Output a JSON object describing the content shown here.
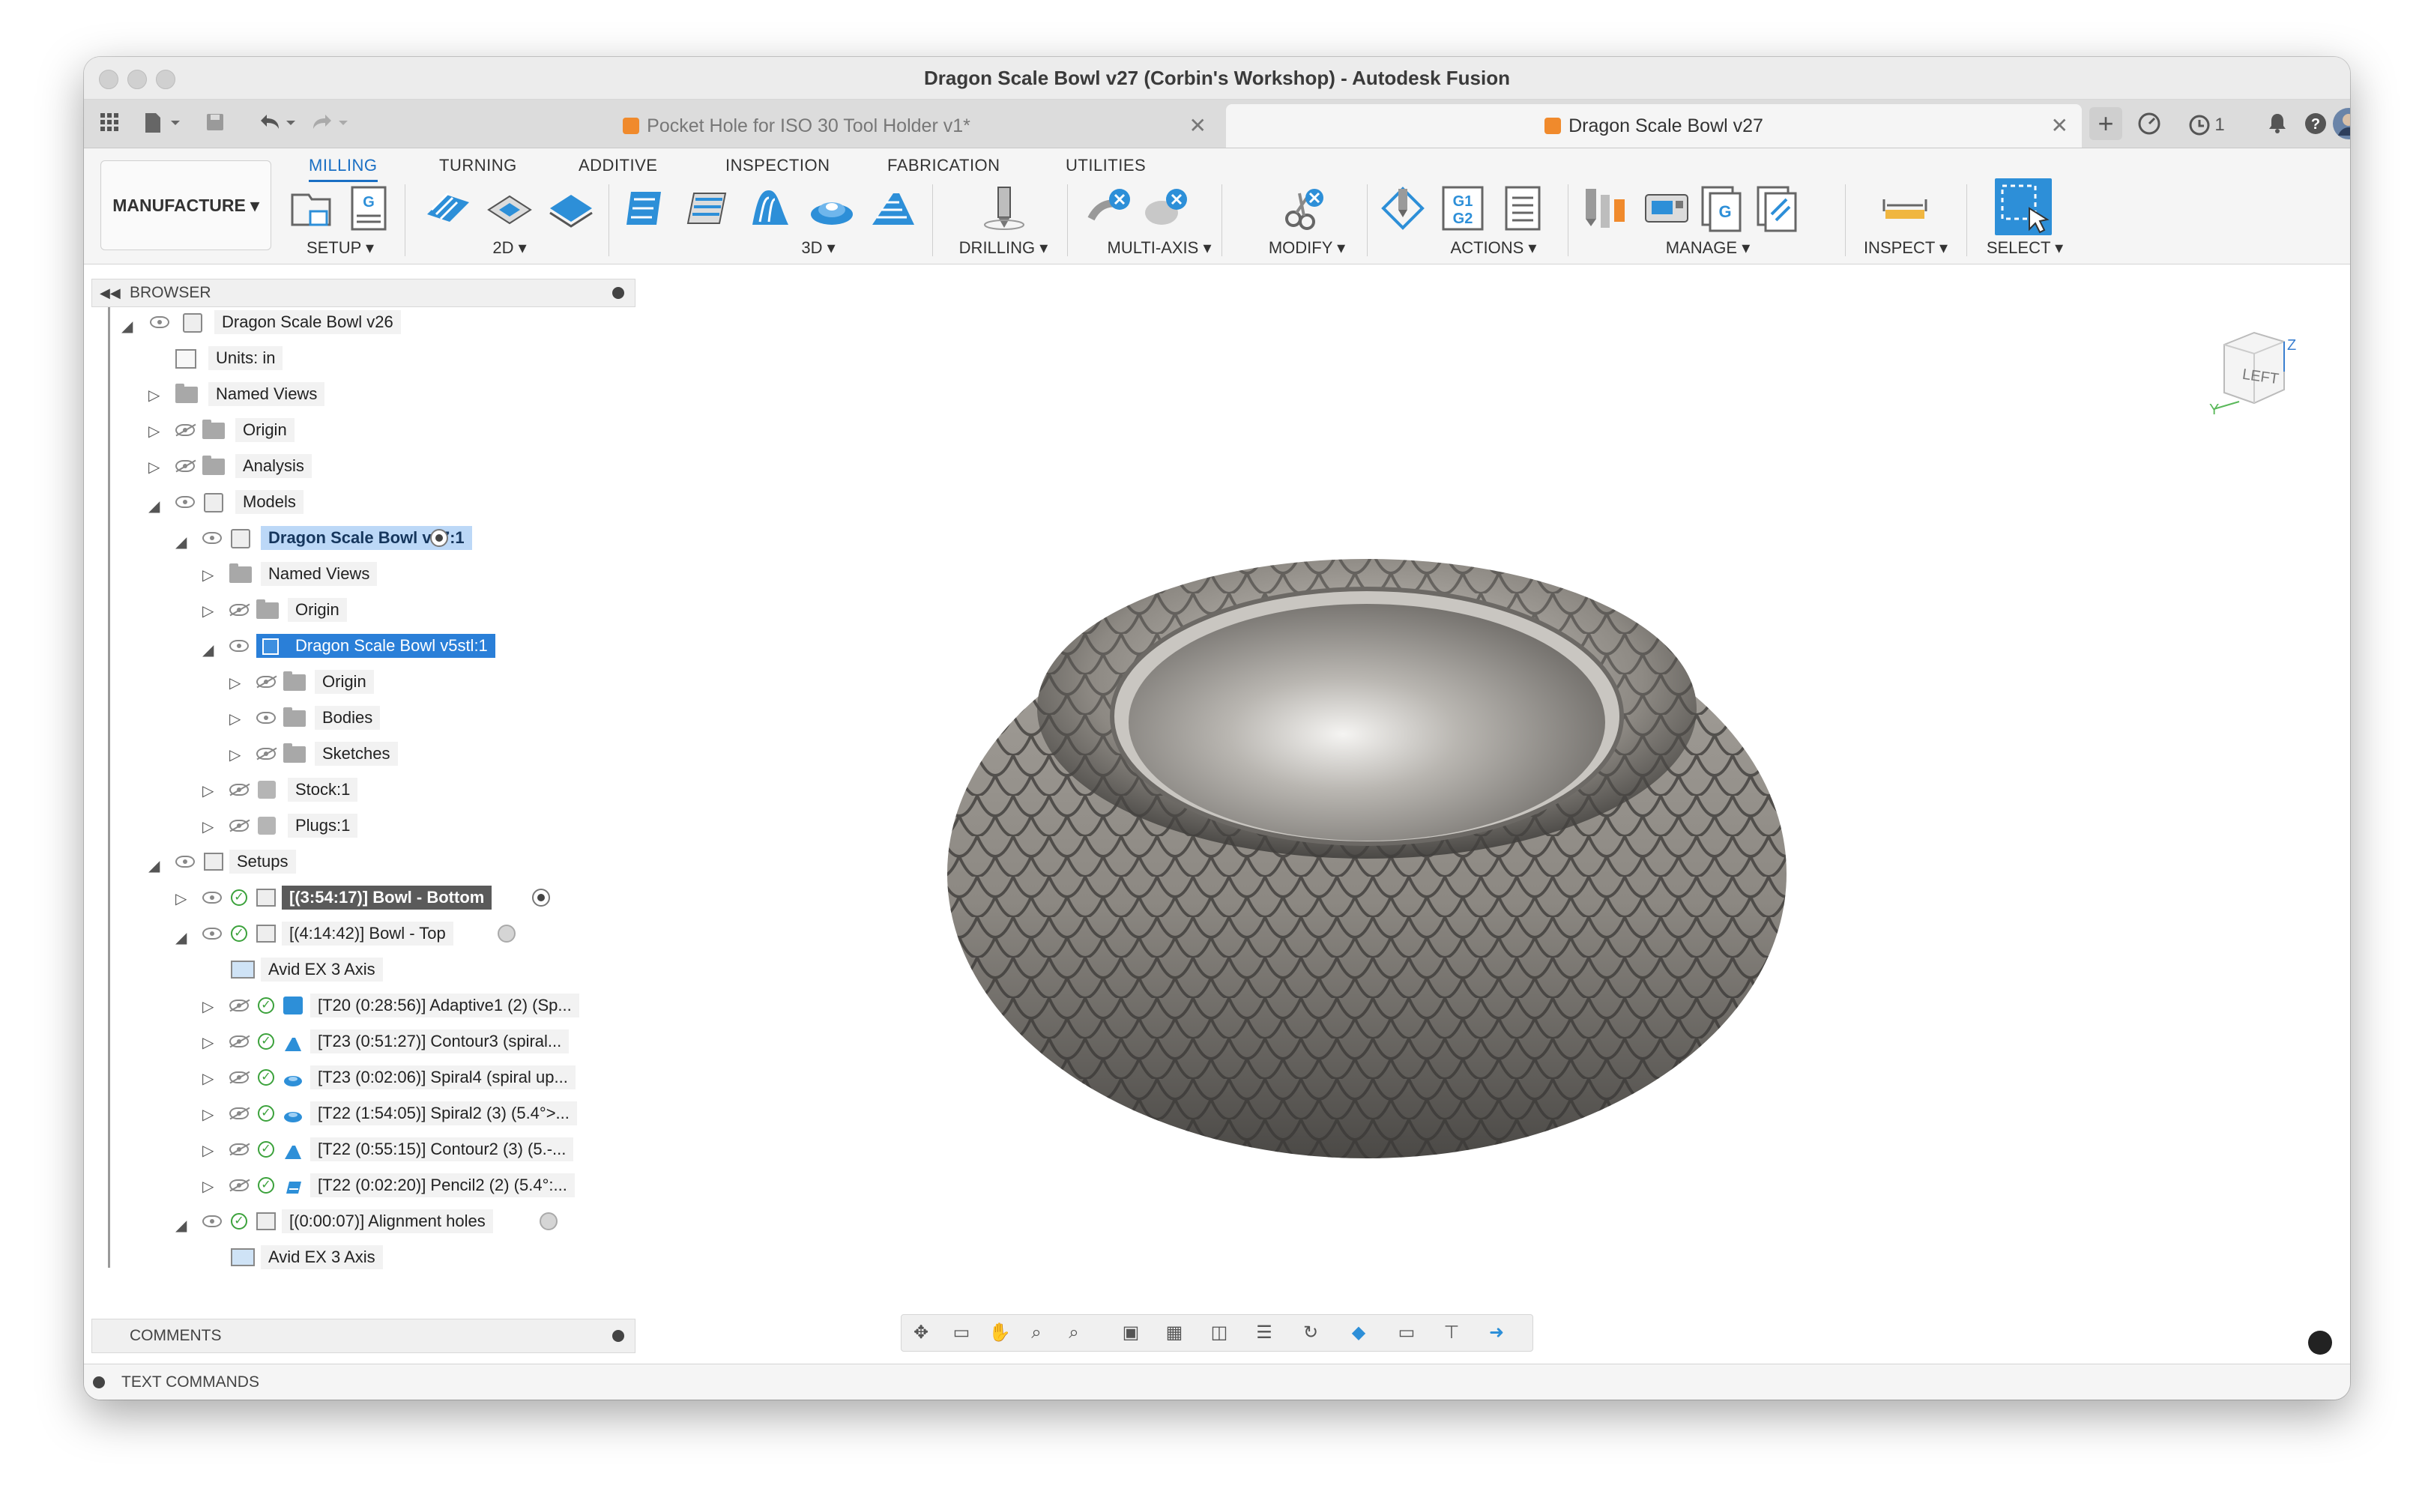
{
  "window": {
    "title": "Dragon Scale Bowl v27 (Corbin's Workshop) - Autodesk Fusion"
  },
  "tabs": [
    {
      "label": "Pocket Hole for ISO 30 Tool Holder v1*",
      "active": false
    },
    {
      "label": "Dragon Scale Bowl v27",
      "active": true
    }
  ],
  "quick": {
    "jobs_count": "1"
  },
  "workspace": {
    "label": "MANUFACTURE"
  },
  "ribbon_tabs": [
    "MILLING",
    "TURNING",
    "ADDITIVE",
    "INSPECTION",
    "FABRICATION",
    "UTILITIES"
  ],
  "groups": {
    "setup": "SETUP",
    "two_d": "2D",
    "three_d": "3D",
    "drilling": "DRILLING",
    "multi_axis": "MULTI-AXIS",
    "modify": "MODIFY",
    "actions": "ACTIONS",
    "manage": "MANAGE",
    "inspect": "INSPECT",
    "select": "SELECT"
  },
  "browser": {
    "header": "BROWSER",
    "rows": [
      {
        "label": "Dragon Scale Bowl v26"
      },
      {
        "label": "Units: in"
      },
      {
        "label": "Named Views"
      },
      {
        "label": "Origin"
      },
      {
        "label": "Analysis"
      },
      {
        "label": "Models"
      },
      {
        "label": "Dragon Scale Bowl v27:1"
      },
      {
        "label": "Named Views"
      },
      {
        "label": "Origin"
      },
      {
        "label": "Dragon Scale Bowl v5stl:1"
      },
      {
        "label": "Origin"
      },
      {
        "label": "Bodies"
      },
      {
        "label": "Sketches"
      },
      {
        "label": "Stock:1"
      },
      {
        "label": "Plugs:1"
      },
      {
        "label": "Setups"
      },
      {
        "label": "[(3:54:17)] Bowl - Bottom"
      },
      {
        "label": "[(4:14:42)] Bowl - Top"
      },
      {
        "label": "Avid EX 3 Axis"
      },
      {
        "label": "[T20 (0:28:56)] Adaptive1 (2) (Sp..."
      },
      {
        "label": "[T23 (0:51:27)] Contour3 (spiral..."
      },
      {
        "label": "[T23 (0:02:06)] Spiral4 (spiral up..."
      },
      {
        "label": "[T22 (1:54:05)] Spiral2 (3) (5.4°>..."
      },
      {
        "label": "[T22 (0:55:15)] Contour2 (3) (5.-..."
      },
      {
        "label": "[T22 (0:02:20)] Pencil2 (2) (5.4°:..."
      },
      {
        "label": "[(0:00:07)] Alignment holes"
      },
      {
        "label": "Avid EX 3 Axis"
      }
    ]
  },
  "comments": {
    "label": "COMMENTS"
  },
  "text_commands": {
    "label": "TEXT COMMANDS"
  },
  "viewcube": {
    "face": "LEFT",
    "axis_z": "Z",
    "axis_y": "Y"
  },
  "colors": {
    "accent": "#1a6fc4",
    "selected": "#2a7fd8",
    "tool_blue": "#2d8fd8"
  }
}
